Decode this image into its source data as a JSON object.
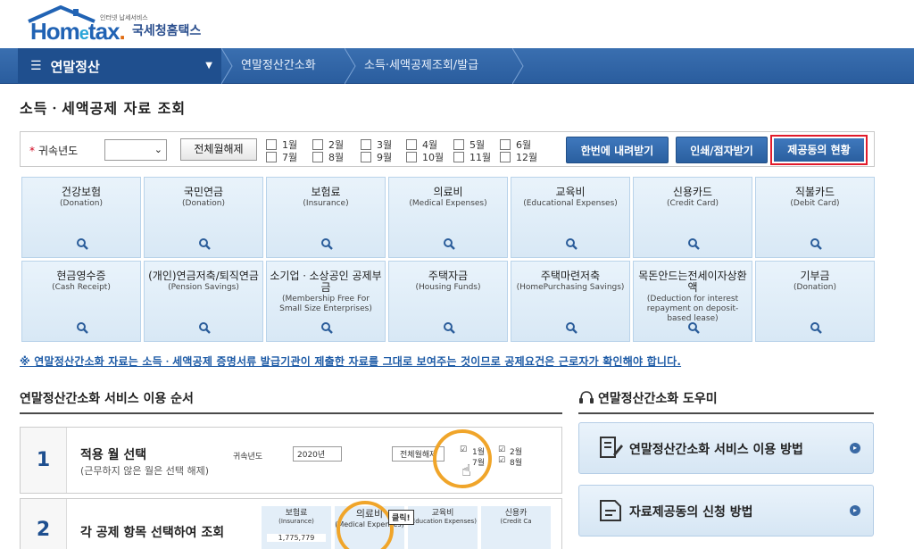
{
  "header": {
    "logo_brand": "Hometax.",
    "logo_sub": "인터넷 납세서비스",
    "logo_korean": "국세청홈택스"
  },
  "nav": {
    "menu_label": "연말정산",
    "crumbs": [
      "연말정산간소화",
      "소득·세액공제조회/발급"
    ]
  },
  "page": {
    "title": "소득ㆍ세액공제 자료 조회"
  },
  "filter": {
    "year_label": "귀속년도",
    "year_value": "",
    "deselect_all": "전체월해제",
    "months": [
      "1월",
      "2월",
      "3월",
      "4월",
      "5월",
      "6월",
      "7월",
      "8월",
      "9월",
      "10월",
      "11월",
      "12월"
    ],
    "download_all": "한번에 내려받기",
    "print_receive": "인쇄/점자받기",
    "provider_status": "제공동의 현황"
  },
  "tiles": [
    {
      "title": "건강보험",
      "sub": "(Donation)"
    },
    {
      "title": "국민연금",
      "sub": "(Donation)"
    },
    {
      "title": "보험료",
      "sub": "(Insurance)"
    },
    {
      "title": "의료비",
      "sub": "(Medical Expenses)"
    },
    {
      "title": "교육비",
      "sub": "(Educational Expenses)"
    },
    {
      "title": "신용카드",
      "sub": "(Credit Card)"
    },
    {
      "title": "직불카드",
      "sub": "(Debit Card)"
    },
    {
      "title": "현금영수증",
      "sub": "(Cash Receipt)"
    },
    {
      "title": "(개인)연금저축/퇴직연금",
      "sub": "(Pension Savings)"
    },
    {
      "title": "소기업ㆍ소상공인 공제부금",
      "sub": "(Membership Free For Small Size Enterprises)"
    },
    {
      "title": "주택자금",
      "sub": "(Housing Funds)"
    },
    {
      "title": "주택마련저축",
      "sub": "(HomePurchasing Savings)"
    },
    {
      "title": "목돈안드는전세이자상환액",
      "sub": "(Deduction for interest repayment on deposit-based lease)"
    },
    {
      "title": "기부금",
      "sub": "(Donation)"
    }
  ],
  "notice": "※ 연말정산간소화 자료는 소득ㆍ세액공제 증명서류 발급기관이 제출한 자료를 그대로 보여주는 것이므로 공제요건은 근로자가 확인해야 합니다.",
  "steps_section": {
    "title": "연말정산간소화 서비스 이용 순서",
    "steps": [
      {
        "num": "1",
        "title": "적용 월 선택",
        "sub": "(근무하지 않은 월은 선택 해제)"
      },
      {
        "num": "2",
        "title": "각 공제 항목 선택하여 조회",
        "sub": ""
      }
    ],
    "mini1": {
      "year_label": "귀속년도",
      "year_value": "2020년",
      "deselect": "전체월해제",
      "m1": "1월",
      "m2": "2월",
      "m7": "7월",
      "m8": "8월"
    },
    "mini2": {
      "t1": "보험료",
      "s1": "(Insurance)",
      "v1": "1,775,779",
      "t2": "의료비",
      "s2": "(Medical Expenses)",
      "t3": "교육비",
      "s3": "(Education Expenses)",
      "t4": "신용카",
      "s4": "(Credit Ca",
      "click": "클릭!"
    }
  },
  "help_section": {
    "title": "연말정산간소화 도우미",
    "buttons": [
      "연말정산간소화 서비스 이용 방법",
      "자료제공동의 신청 방법"
    ]
  },
  "colors": {
    "nav_blue": "#2a5d9e",
    "tile_bg": "#dfecf7",
    "highlight_red": "#e21b2b",
    "notice_blue": "#1c5aa6",
    "click_circle": "#f0a52a"
  }
}
